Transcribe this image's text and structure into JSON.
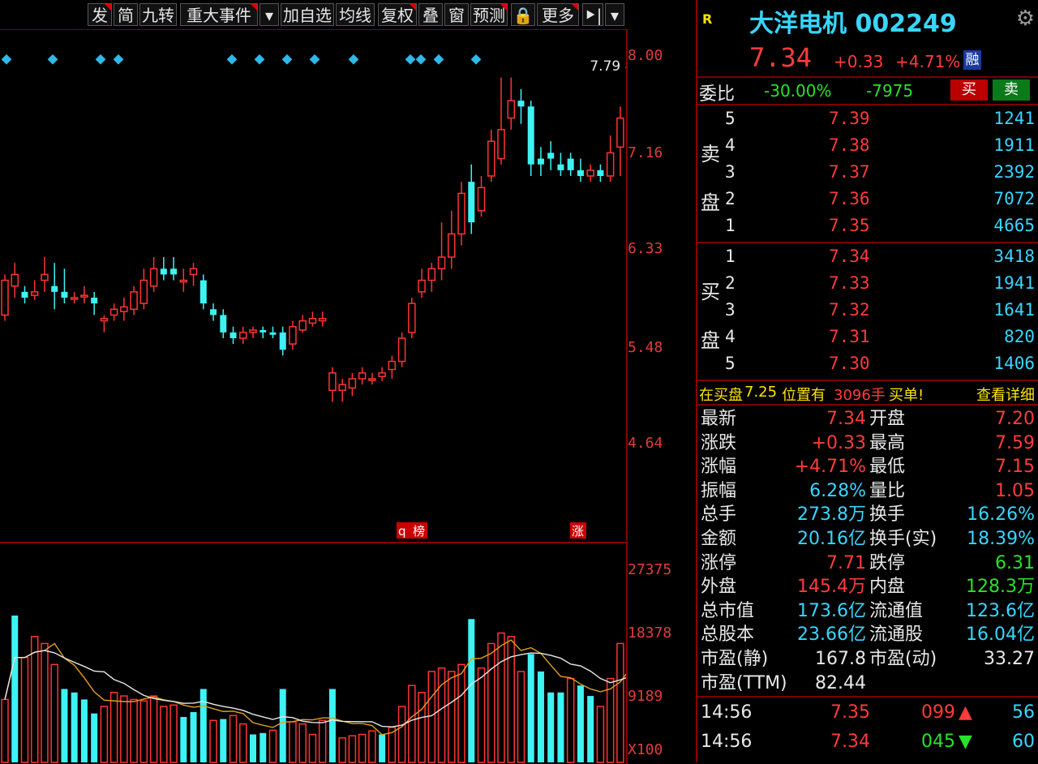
{
  "toolbar": {
    "items": [
      "发",
      "简",
      "九转",
      "重大事件",
      "▾",
      "加自选",
      "均线",
      "复权",
      "叠",
      "窗",
      "预测",
      "🔒",
      "更多",
      "⯈|",
      "▾"
    ]
  },
  "chart_data": {
    "type": "candlestick",
    "price_axis_ticks": [
      "8.00",
      "7.16",
      "6.33",
      "5.48",
      "4.64"
    ],
    "volume_axis_ticks": [
      "27375",
      "18378",
      "9189",
      "X100"
    ],
    "marker_high_label": "7.79",
    "bottom_tags": [
      "q",
      "榜",
      "涨"
    ],
    "candles": [
      [
        5.75,
        6.05,
        5.7,
        6.1
      ],
      [
        6.0,
        6.1,
        5.9,
        6.2
      ],
      [
        5.95,
        5.9,
        5.85,
        6.0
      ],
      [
        5.92,
        5.95,
        5.88,
        6.05
      ],
      [
        6.05,
        6.1,
        5.95,
        6.25
      ],
      [
        6.0,
        5.95,
        5.8,
        6.2
      ],
      [
        5.95,
        5.9,
        5.85,
        6.15
      ],
      [
        5.9,
        5.9,
        5.85,
        5.95
      ],
      [
        5.92,
        5.92,
        5.85,
        6.0
      ],
      [
        5.9,
        5.85,
        5.75,
        5.95
      ],
      [
        5.7,
        5.72,
        5.6,
        5.75
      ],
      [
        5.75,
        5.8,
        5.7,
        5.85
      ],
      [
        5.78,
        5.82,
        5.7,
        5.9
      ],
      [
        5.8,
        5.95,
        5.75,
        6.0
      ],
      [
        5.85,
        6.05,
        5.8,
        6.15
      ],
      [
        6.0,
        6.15,
        5.95,
        6.25
      ],
      [
        6.15,
        6.1,
        6.05,
        6.25
      ],
      [
        6.15,
        6.1,
        6.05,
        6.25
      ],
      [
        6.05,
        6.05,
        5.95,
        6.15
      ],
      [
        6.1,
        6.15,
        6.0,
        6.2
      ],
      [
        6.05,
        5.85,
        5.8,
        6.1
      ],
      [
        5.8,
        5.75,
        5.7,
        5.85
      ],
      [
        5.75,
        5.6,
        5.55,
        5.8
      ],
      [
        5.6,
        5.55,
        5.5,
        5.65
      ],
      [
        5.55,
        5.6,
        5.5,
        5.65
      ],
      [
        5.6,
        5.62,
        5.55,
        5.65
      ],
      [
        5.62,
        5.6,
        5.55,
        5.65
      ],
      [
        5.6,
        5.58,
        5.55,
        5.65
      ],
      [
        5.6,
        5.45,
        5.4,
        5.65
      ],
      [
        5.5,
        5.65,
        5.45,
        5.7
      ],
      [
        5.62,
        5.7,
        5.6,
        5.75
      ],
      [
        5.68,
        5.72,
        5.65,
        5.78
      ],
      [
        5.7,
        5.72,
        5.65,
        5.78
      ],
      [
        5.1,
        5.25,
        5.0,
        5.3
      ],
      [
        5.1,
        5.15,
        5.0,
        5.2
      ],
      [
        5.12,
        5.2,
        5.05,
        5.25
      ],
      [
        5.2,
        5.25,
        5.15,
        5.3
      ],
      [
        5.2,
        5.2,
        5.15,
        5.25
      ],
      [
        5.22,
        5.25,
        5.18,
        5.3
      ],
      [
        5.28,
        5.35,
        5.2,
        5.4
      ],
      [
        5.35,
        5.55,
        5.3,
        5.6
      ],
      [
        5.6,
        5.85,
        5.55,
        5.9
      ],
      [
        5.95,
        6.05,
        5.9,
        6.15
      ],
      [
        6.05,
        6.15,
        5.95,
        6.2
      ],
      [
        6.15,
        6.25,
        6.05,
        6.55
      ],
      [
        6.25,
        6.45,
        6.15,
        6.65
      ],
      [
        6.45,
        6.8,
        6.35,
        6.9
      ],
      [
        6.9,
        6.55,
        6.45,
        7.05
      ],
      [
        6.65,
        6.85,
        6.6,
        6.95
      ],
      [
        6.95,
        7.25,
        6.9,
        7.35
      ],
      [
        7.1,
        7.35,
        7.05,
        7.8
      ],
      [
        7.45,
        7.6,
        7.35,
        7.8
      ],
      [
        7.6,
        7.55,
        7.4,
        7.7
      ],
      [
        7.55,
        7.05,
        6.95,
        7.6
      ],
      [
        7.1,
        7.05,
        6.95,
        7.2
      ],
      [
        7.15,
        7.1,
        7.0,
        7.25
      ],
      [
        7.05,
        7.0,
        6.95,
        7.15
      ],
      [
        7.1,
        7.0,
        6.95,
        7.15
      ],
      [
        7.0,
        6.95,
        6.9,
        7.1
      ],
      [
        6.95,
        7.0,
        6.9,
        7.05
      ],
      [
        7.0,
        6.95,
        6.9,
        7.05
      ],
      [
        6.95,
        7.15,
        6.9,
        7.3
      ],
      [
        7.2,
        7.45,
        6.95,
        7.55
      ],
      [
        6.85,
        6.85,
        6.7,
        6.95
      ],
      [
        7.2,
        7.34,
        7.15,
        7.79
      ]
    ],
    "volumes": [
      [
        9000,
        0
      ],
      [
        21000,
        1
      ],
      [
        15000,
        0
      ],
      [
        18000,
        0
      ],
      [
        17000,
        0
      ],
      [
        14000,
        0
      ],
      [
        10500,
        1
      ],
      [
        10000,
        1
      ],
      [
        9000,
        1
      ],
      [
        7000,
        1
      ],
      [
        8000,
        0
      ],
      [
        10000,
        0
      ],
      [
        9500,
        0
      ],
      [
        9000,
        0
      ],
      [
        8800,
        0
      ],
      [
        9500,
        0
      ],
      [
        8000,
        0
      ],
      [
        8200,
        0
      ],
      [
        6500,
        1
      ],
      [
        7200,
        1
      ],
      [
        10500,
        1
      ],
      [
        6000,
        0
      ],
      [
        6200,
        1
      ],
      [
        6700,
        0
      ],
      [
        5500,
        0
      ],
      [
        4000,
        1
      ],
      [
        4200,
        1
      ],
      [
        4600,
        0
      ],
      [
        10500,
        1
      ],
      [
        5800,
        0
      ],
      [
        5500,
        0
      ],
      [
        4000,
        0
      ],
      [
        6000,
        0
      ],
      [
        10500,
        1
      ],
      [
        3500,
        0
      ],
      [
        3800,
        0
      ],
      [
        4000,
        0
      ],
      [
        4500,
        0
      ],
      [
        4000,
        1
      ],
      [
        5000,
        0
      ],
      [
        8000,
        0
      ],
      [
        11000,
        0
      ],
      [
        10000,
        0
      ],
      [
        13000,
        0
      ],
      [
        13500,
        0
      ],
      [
        13000,
        0
      ],
      [
        14000,
        0
      ],
      [
        20500,
        1
      ],
      [
        13500,
        0
      ],
      [
        17000,
        0
      ],
      [
        18500,
        0
      ],
      [
        18000,
        0
      ],
      [
        13000,
        0
      ],
      [
        15500,
        1
      ],
      [
        13000,
        1
      ],
      [
        10000,
        1
      ],
      [
        10000,
        1
      ],
      [
        12000,
        0
      ],
      [
        11000,
        1
      ],
      [
        9500,
        1
      ],
      [
        8000,
        0
      ],
      [
        12000,
        0
      ],
      [
        17000,
        0
      ],
      [
        20500,
        1
      ],
      [
        26000,
        0
      ]
    ]
  },
  "header": {
    "r_mark": "R",
    "stock_name": "大洋电机 002249",
    "price": "7.34",
    "change": "+0.33",
    "change_pct": "+4.71%",
    "tag": "融"
  },
  "weibi": {
    "label": "委比",
    "pct": "-30.00%",
    "diff": "-7975",
    "buy_btn": "买",
    "sell_btn": "卖"
  },
  "asks": {
    "label_a": "卖",
    "label_b": "盘",
    "rows": [
      {
        "lvl": "5",
        "price": "7.39",
        "vol": "1241"
      },
      {
        "lvl": "4",
        "price": "7.38",
        "vol": "1911"
      },
      {
        "lvl": "3",
        "price": "7.37",
        "vol": "2392"
      },
      {
        "lvl": "2",
        "price": "7.36",
        "vol": "7072"
      },
      {
        "lvl": "1",
        "price": "7.35",
        "vol": "4665"
      }
    ]
  },
  "bids": {
    "label_a": "买",
    "label_b": "盘",
    "rows": [
      {
        "lvl": "1",
        "price": "7.34",
        "vol": "3418"
      },
      {
        "lvl": "2",
        "price": "7.33",
        "vol": "1941"
      },
      {
        "lvl": "3",
        "price": "7.32",
        "vol": "1641"
      },
      {
        "lvl": "4",
        "price": "7.31",
        "vol": "820"
      },
      {
        "lvl": "5",
        "price": "7.30",
        "vol": "1406"
      }
    ]
  },
  "alert": {
    "text_a": "在买盘",
    "price": "7.25",
    "text_b": "位置有",
    "qty": "3096手",
    "text_c": "买单!",
    "link": "查看详细"
  },
  "stats": [
    {
      "l1": "最新",
      "v1": "7.34",
      "c1": "red",
      "l2": "开盘",
      "v2": "7.20",
      "c2": "red"
    },
    {
      "l1": "涨跌",
      "v1": "+0.33",
      "c1": "red",
      "l2": "最高",
      "v2": "7.59",
      "c2": "red"
    },
    {
      "l1": "涨幅",
      "v1": "+4.71%",
      "c1": "red",
      "l2": "最低",
      "v2": "7.15",
      "c2": "red"
    },
    {
      "l1": "振幅",
      "v1": "6.28%",
      "c1": "cyan",
      "l2": "量比",
      "v2": "1.05",
      "c2": "red"
    },
    {
      "l1": "总手",
      "v1": "273.8万",
      "c1": "cyan",
      "l2": "换手",
      "v2": "16.26%",
      "c2": "cyan"
    },
    {
      "l1": "金额",
      "v1": "20.16亿",
      "c1": "cyan",
      "l2": "换手(实)",
      "v2": "18.39%",
      "c2": "cyan"
    },
    {
      "l1": "涨停",
      "v1": "7.71",
      "c1": "red",
      "l2": "跌停",
      "v2": "6.31",
      "c2": "green"
    },
    {
      "l1": "外盘",
      "v1": "145.4万",
      "c1": "red",
      "l2": "内盘",
      "v2": "128.3万",
      "c2": "green"
    },
    {
      "l1": "总市值",
      "v1": "173.6亿",
      "c1": "cyan",
      "l2": "流通值",
      "v2": "123.6亿",
      "c2": "cyan"
    },
    {
      "l1": "总股本",
      "v1": "23.66亿",
      "c1": "cyan",
      "l2": "流通股",
      "v2": "16.04亿",
      "c2": "cyan"
    },
    {
      "l1": "市盈(静)",
      "v1": "167.8",
      "c1": "white",
      "l2": "市盈(动)",
      "v2": "33.27",
      "c2": "white"
    },
    {
      "l1": "市盈(TTM)",
      "v1": "82.44",
      "c1": "white",
      "l2": "",
      "v2": "",
      "c2": "white"
    }
  ],
  "ticks": [
    {
      "time": "14:56",
      "price": "7.35",
      "count": "099",
      "dir": "up",
      "vol": "56"
    },
    {
      "time": "14:56",
      "price": "7.34",
      "count": "045",
      "dir": "down",
      "vol": "60"
    }
  ],
  "colors": {
    "up": "#ff3333",
    "down": "#3df3f3",
    "ma1": "#e8e8e8",
    "ma2": "#e0a020",
    "frame": "#8a0000"
  }
}
